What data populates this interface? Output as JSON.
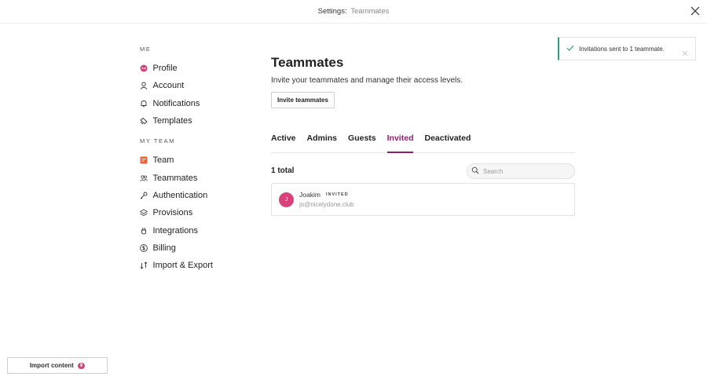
{
  "header": {
    "prefix": "Settings:",
    "current": "Teammates"
  },
  "sidebar": {
    "me_title": "ME",
    "me_items": [
      {
        "label": "Profile",
        "icon": "profile-icon"
      },
      {
        "label": "Account",
        "icon": "account-icon"
      },
      {
        "label": "Notifications",
        "icon": "bell-icon"
      },
      {
        "label": "Templates",
        "icon": "templates-icon"
      }
    ],
    "team_title": "MY TEAM",
    "team_items": [
      {
        "label": "Team",
        "icon": "team-icon"
      },
      {
        "label": "Teammates",
        "icon": "teammates-icon"
      },
      {
        "label": "Authentication",
        "icon": "key-icon"
      },
      {
        "label": "Provisions",
        "icon": "layers-icon"
      },
      {
        "label": "Integrations",
        "icon": "integrations-icon"
      },
      {
        "label": "Billing",
        "icon": "dollar-icon"
      },
      {
        "label": "Import & Export",
        "icon": "import-export-icon"
      }
    ]
  },
  "main": {
    "title": "Teammates",
    "description": "Invite your teammates and manage their access levels.",
    "invite_button": "Invite teammates",
    "tabs": [
      {
        "label": "Active",
        "active": false
      },
      {
        "label": "Admins",
        "active": false
      },
      {
        "label": "Guests",
        "active": false
      },
      {
        "label": "Invited",
        "active": true
      },
      {
        "label": "Deactivated",
        "active": false
      }
    ],
    "total": "1 total",
    "search_placeholder": "Search",
    "rows": [
      {
        "initial": "J",
        "name": "Joakim",
        "badge": "INVITED",
        "email": "jo@nicelydone.club"
      }
    ]
  },
  "toast": {
    "message": "Invitations sent to 1 teammate."
  },
  "footer": {
    "import_label": "Import content",
    "import_count": "9"
  },
  "colors": {
    "accent": "#8e1f6e",
    "avatar": "#d9417a",
    "success": "#2fa37a"
  }
}
